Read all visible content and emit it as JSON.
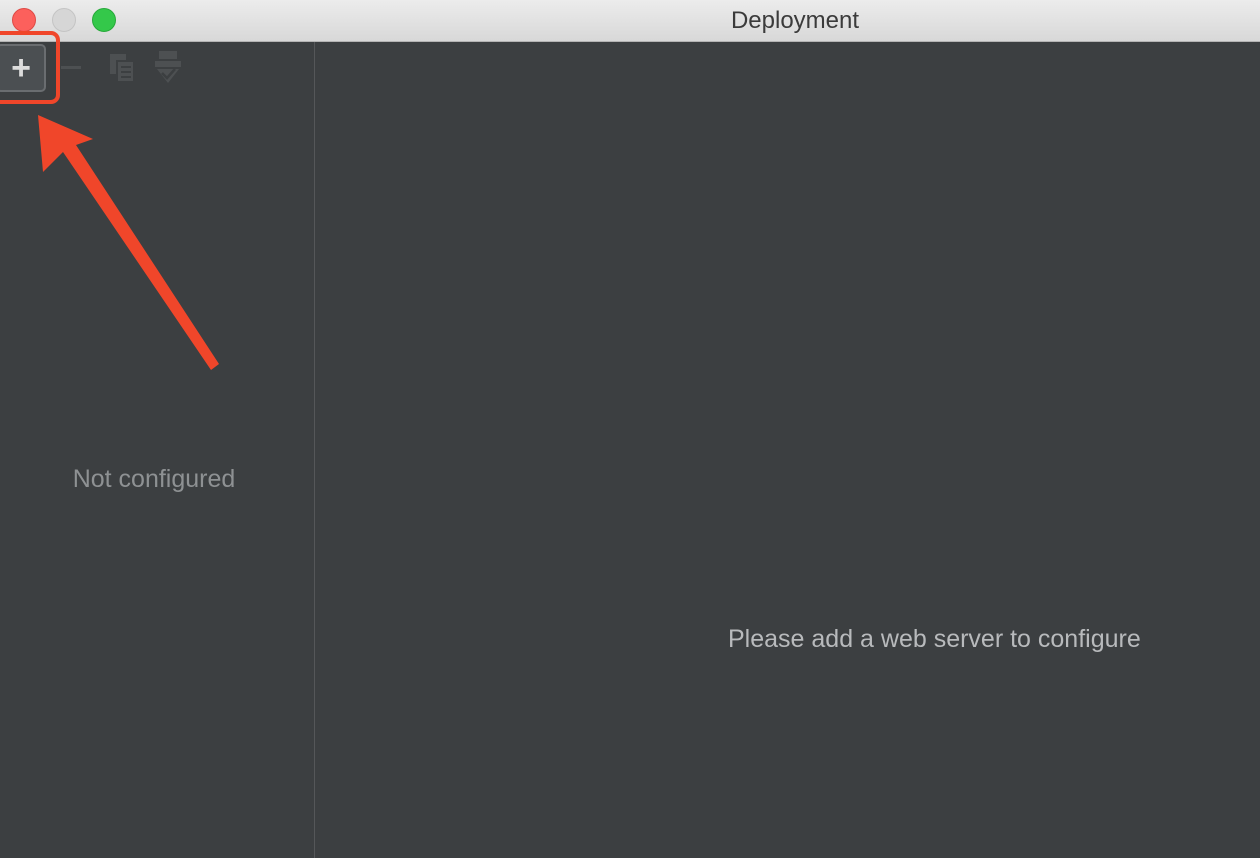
{
  "window": {
    "title": "Deployment"
  },
  "toolbar": {
    "add_label": "+",
    "buttons": [
      "plus-icon",
      "minus-icon",
      "copy-icon",
      "use-as-default-icon"
    ]
  },
  "left_panel": {
    "empty_text": "Not configured"
  },
  "right_panel": {
    "empty_text": "Please add a web server to configure"
  },
  "annotation": {
    "color": "#f0462a"
  }
}
